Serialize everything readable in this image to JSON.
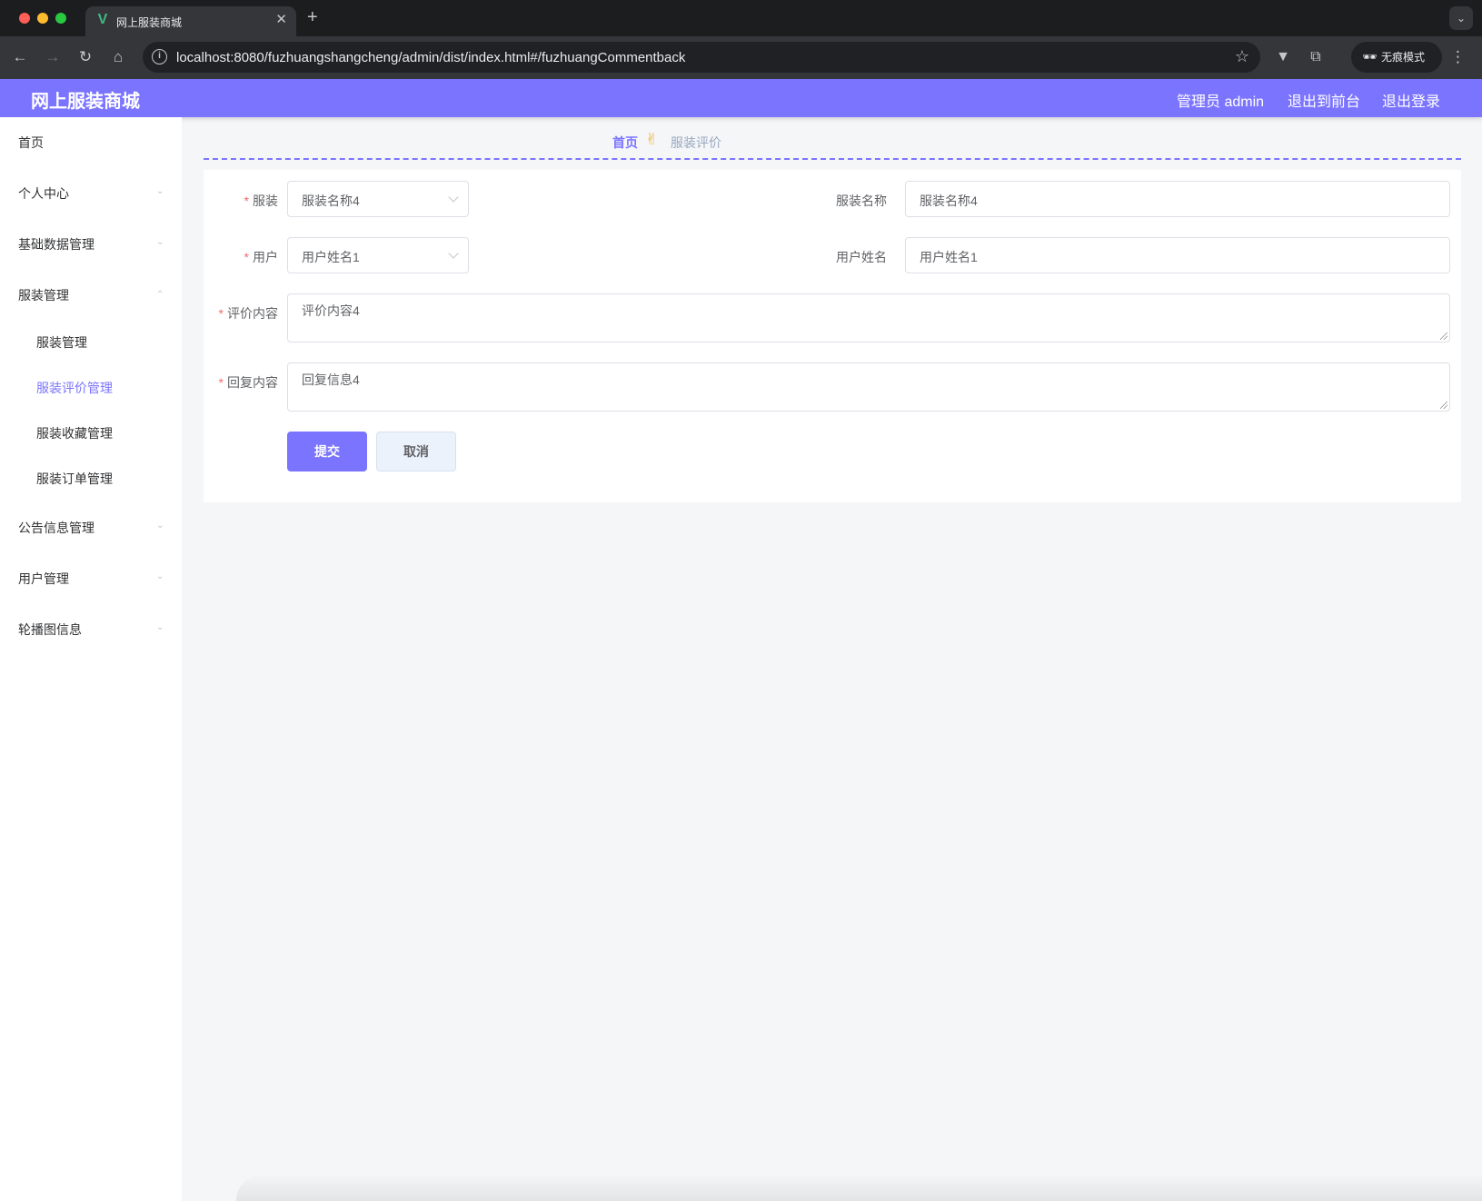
{
  "browser": {
    "tab_title": "网上服装商城",
    "url": "localhost:8080/fuzhuangshangcheng/admin/dist/index.html#/fuzhuangCommentback",
    "incognito_label": "无痕模式"
  },
  "header": {
    "brand": "网上服装商城",
    "user_label": "管理员 admin",
    "back_to_front": "退出到前台",
    "logout": "退出登录"
  },
  "sidebar": {
    "items": [
      {
        "label": "首页"
      },
      {
        "label": "个人中心"
      },
      {
        "label": "基础数据管理"
      },
      {
        "label": "服装管理"
      },
      {
        "label": "公告信息管理"
      },
      {
        "label": "用户管理"
      },
      {
        "label": "轮播图信息"
      }
    ],
    "sub_items": [
      {
        "label": "服装管理"
      },
      {
        "label": "服装评价管理"
      },
      {
        "label": "服装收藏管理"
      },
      {
        "label": "服装订单管理"
      }
    ]
  },
  "breadcrumb": {
    "home": "首页",
    "separator": "✌",
    "current": "服装评价"
  },
  "form": {
    "required_mark": "*",
    "clothing_label": "服装",
    "clothing_value": "服装名称4",
    "clothing_name_label": "服装名称",
    "clothing_name_value": "服装名称4",
    "user_label": "用户",
    "user_value": "用户姓名1",
    "user_name_label": "用户姓名",
    "user_name_value": "用户姓名1",
    "comment_label": "评价内容",
    "comment_value": "评价内容4",
    "reply_label": "回复内容",
    "reply_value": "回复信息4",
    "submit": "提交",
    "cancel": "取消"
  },
  "colors": {
    "accent": "#7b74ff",
    "required": "#f56c6c",
    "breadcrumb_current": "#97a8be"
  }
}
